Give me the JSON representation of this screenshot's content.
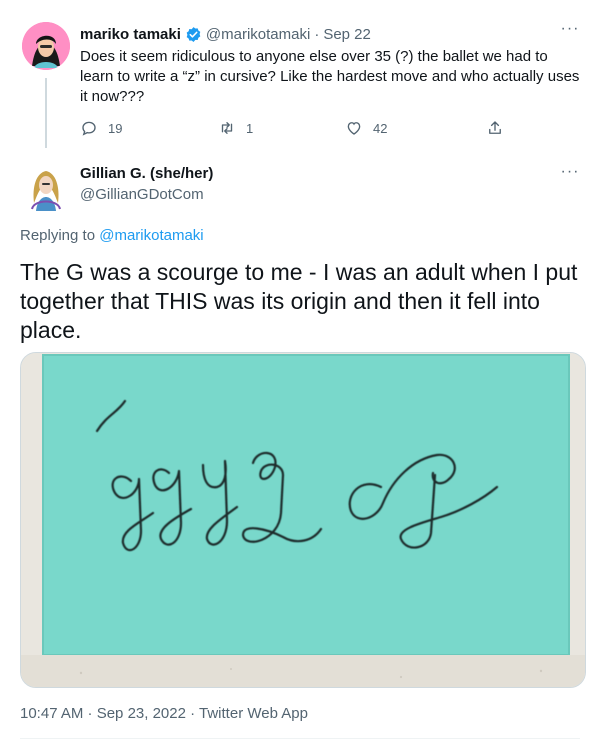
{
  "parent_tweet": {
    "name": "mariko tamaki",
    "handle": "@marikotamaki",
    "date": "Sep 22",
    "text": "Does it seem ridiculous to anyone else over 35 (?) the ballet we had to learn to write a “z” in cursive? Like the hardest move and who actually uses it now???",
    "reply_count": "19",
    "retweet_count": "1",
    "like_count": "42"
  },
  "main_tweet": {
    "name": "Gillian G. (she/her)",
    "handle": "@GillianGDotCom",
    "replying_prefix": "Replying to",
    "replying_to": "@marikotamaki",
    "text": "The G was a scourge to me - I was an adult when I put together that THIS was its origin and then it fell into place.",
    "timestamp": "10:47 AM · Sep 23, 2022 · Twitter Web App"
  },
  "icons": {
    "verified": "verified-badge-icon",
    "more": "more-icon",
    "reply": "reply-icon",
    "retweet": "retweet-icon",
    "like": "like-icon",
    "share": "share-icon"
  },
  "colors": {
    "accent": "#1d9bf0",
    "muted": "#536471",
    "sticky_note": "#73d6c9"
  }
}
